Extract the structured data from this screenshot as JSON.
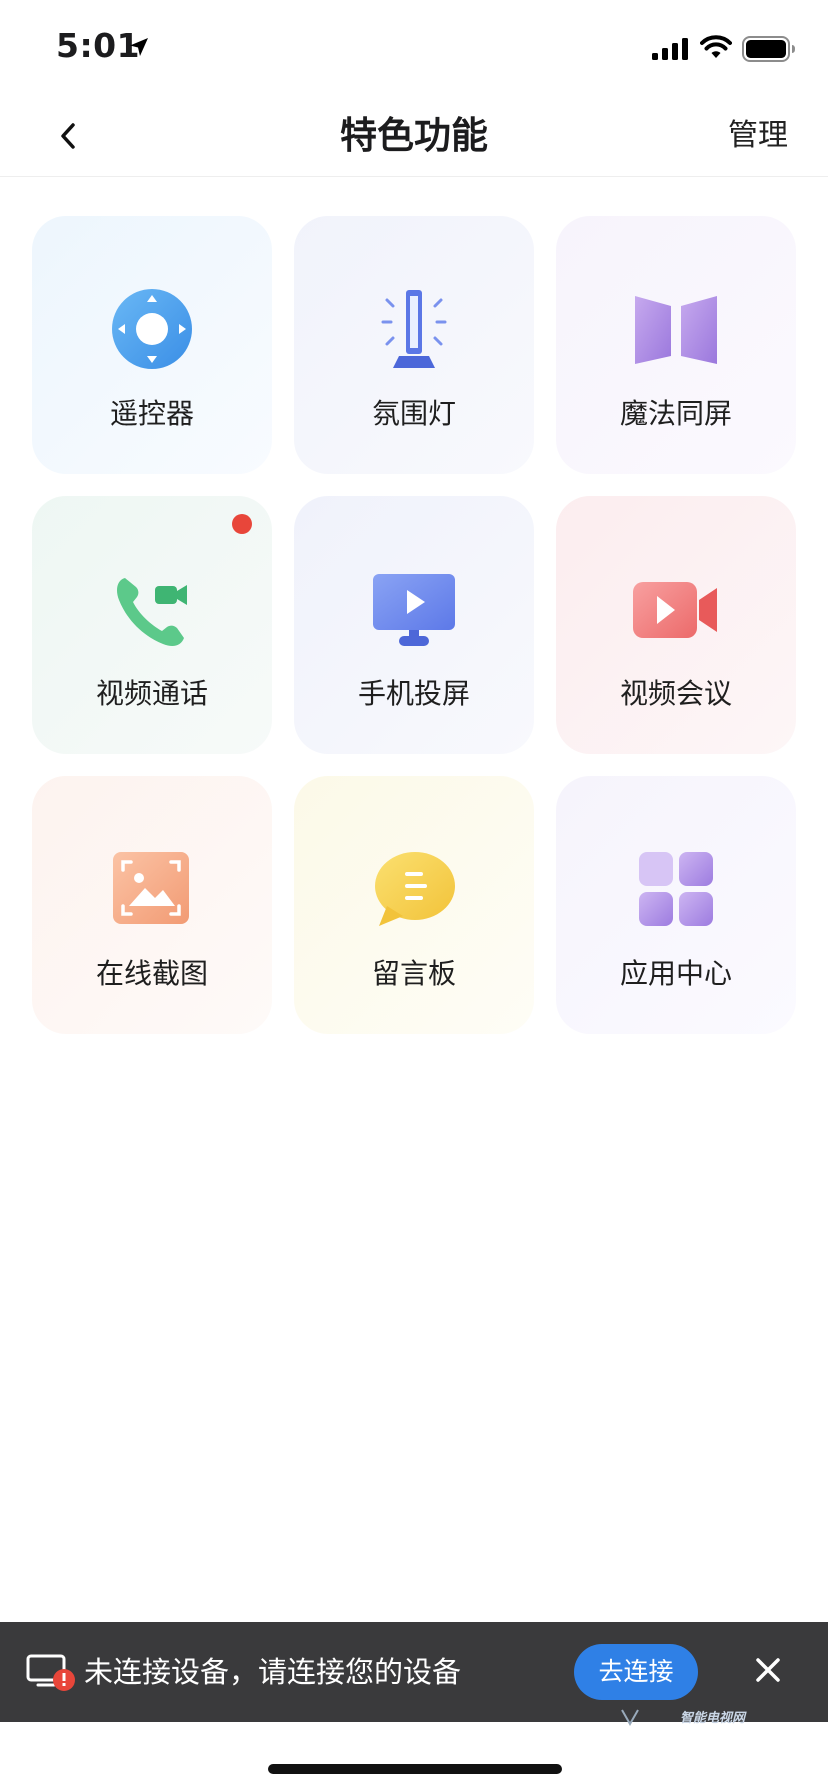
{
  "status_bar": {
    "time": "5:01"
  },
  "nav": {
    "title": "特色功能",
    "manage_label": "管理"
  },
  "tiles": [
    {
      "label": "遥控器",
      "icon": "remote-control-icon"
    },
    {
      "label": "氛围灯",
      "icon": "ambient-light-icon"
    },
    {
      "label": "魔法同屏",
      "icon": "magic-screen-icon"
    },
    {
      "label": "视频通话",
      "icon": "video-call-icon",
      "badge": true
    },
    {
      "label": "手机投屏",
      "icon": "screen-cast-icon"
    },
    {
      "label": "视频会议",
      "icon": "video-meeting-icon"
    },
    {
      "label": "在线截图",
      "icon": "screenshot-icon"
    },
    {
      "label": "留言板",
      "icon": "message-board-icon"
    },
    {
      "label": "应用中心",
      "icon": "app-center-icon"
    }
  ],
  "banner": {
    "text": "未连接设备，请连接您的设备",
    "connect_label": "去连接",
    "watermark": "智能电视网"
  },
  "colors": {
    "accent_blue": "#2f80e6",
    "banner_bg": "#3a3a3c",
    "badge_red": "#e8463a"
  }
}
